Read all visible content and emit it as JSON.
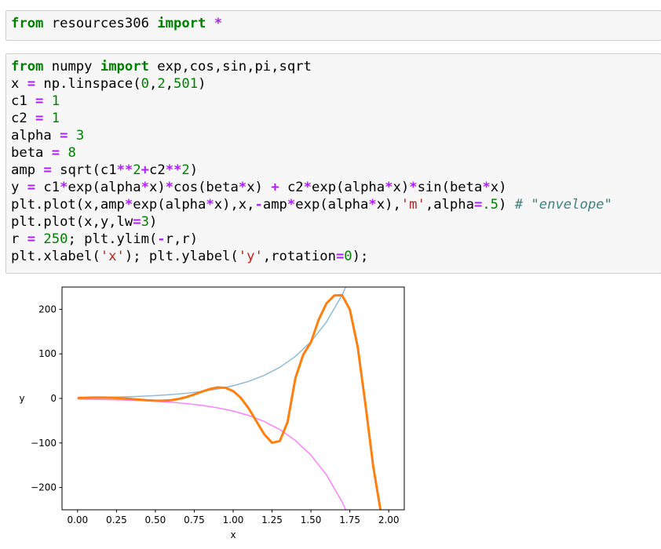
{
  "cells": [
    {
      "lines": [
        [
          {
            "t": "kw",
            "v": "from"
          },
          {
            "t": "plain",
            "v": " resources306 "
          },
          {
            "t": "kw",
            "v": "import"
          },
          {
            "t": "plain",
            "v": " "
          },
          {
            "t": "op",
            "v": "*"
          }
        ]
      ]
    },
    {
      "lines": [
        [
          {
            "t": "kw",
            "v": "from"
          },
          {
            "t": "plain",
            "v": " numpy "
          },
          {
            "t": "kw",
            "v": "import"
          },
          {
            "t": "plain",
            "v": " exp,cos,sin,pi,sqrt"
          }
        ],
        [
          {
            "t": "plain",
            "v": "x "
          },
          {
            "t": "op",
            "v": "="
          },
          {
            "t": "plain",
            "v": " np.linspace("
          },
          {
            "t": "num",
            "v": "0"
          },
          {
            "t": "plain",
            "v": ","
          },
          {
            "t": "num",
            "v": "2"
          },
          {
            "t": "plain",
            "v": ","
          },
          {
            "t": "num",
            "v": "501"
          },
          {
            "t": "plain",
            "v": ")"
          }
        ],
        [
          {
            "t": "plain",
            "v": "c1 "
          },
          {
            "t": "op",
            "v": "="
          },
          {
            "t": "plain",
            "v": " "
          },
          {
            "t": "num",
            "v": "1"
          }
        ],
        [
          {
            "t": "plain",
            "v": "c2 "
          },
          {
            "t": "op",
            "v": "="
          },
          {
            "t": "plain",
            "v": " "
          },
          {
            "t": "num",
            "v": "1"
          }
        ],
        [
          {
            "t": "plain",
            "v": "alpha "
          },
          {
            "t": "op",
            "v": "="
          },
          {
            "t": "plain",
            "v": " "
          },
          {
            "t": "num",
            "v": "3"
          }
        ],
        [
          {
            "t": "plain",
            "v": "beta "
          },
          {
            "t": "op",
            "v": "="
          },
          {
            "t": "plain",
            "v": " "
          },
          {
            "t": "num",
            "v": "8"
          }
        ],
        [
          {
            "t": "plain",
            "v": "amp "
          },
          {
            "t": "op",
            "v": "="
          },
          {
            "t": "plain",
            "v": " sqrt(c1"
          },
          {
            "t": "op",
            "v": "**"
          },
          {
            "t": "num",
            "v": "2"
          },
          {
            "t": "op",
            "v": "+"
          },
          {
            "t": "plain",
            "v": "c2"
          },
          {
            "t": "op",
            "v": "**"
          },
          {
            "t": "num",
            "v": "2"
          },
          {
            "t": "plain",
            "v": ")"
          }
        ],
        [
          {
            "t": "plain",
            "v": "y "
          },
          {
            "t": "op",
            "v": "="
          },
          {
            "t": "plain",
            "v": " c1"
          },
          {
            "t": "op",
            "v": "*"
          },
          {
            "t": "plain",
            "v": "exp(alpha"
          },
          {
            "t": "op",
            "v": "*"
          },
          {
            "t": "plain",
            "v": "x)"
          },
          {
            "t": "op",
            "v": "*"
          },
          {
            "t": "plain",
            "v": "cos(beta"
          },
          {
            "t": "op",
            "v": "*"
          },
          {
            "t": "plain",
            "v": "x) "
          },
          {
            "t": "op",
            "v": "+"
          },
          {
            "t": "plain",
            "v": " c2"
          },
          {
            "t": "op",
            "v": "*"
          },
          {
            "t": "plain",
            "v": "exp(alpha"
          },
          {
            "t": "op",
            "v": "*"
          },
          {
            "t": "plain",
            "v": "x)"
          },
          {
            "t": "op",
            "v": "*"
          },
          {
            "t": "plain",
            "v": "sin(beta"
          },
          {
            "t": "op",
            "v": "*"
          },
          {
            "t": "plain",
            "v": "x)"
          }
        ],
        [
          {
            "t": "plain",
            "v": "plt.plot(x,amp"
          },
          {
            "t": "op",
            "v": "*"
          },
          {
            "t": "plain",
            "v": "exp(alpha"
          },
          {
            "t": "op",
            "v": "*"
          },
          {
            "t": "plain",
            "v": "x),x,"
          },
          {
            "t": "op",
            "v": "-"
          },
          {
            "t": "plain",
            "v": "amp"
          },
          {
            "t": "op",
            "v": "*"
          },
          {
            "t": "plain",
            "v": "exp(alpha"
          },
          {
            "t": "op",
            "v": "*"
          },
          {
            "t": "plain",
            "v": "x),"
          },
          {
            "t": "str",
            "v": "'m'"
          },
          {
            "t": "plain",
            "v": ",alpha"
          },
          {
            "t": "op",
            "v": "="
          },
          {
            "t": "num",
            "v": ".5"
          },
          {
            "t": "plain",
            "v": ") "
          },
          {
            "t": "cmt",
            "v": "# \"envelope\""
          }
        ],
        [
          {
            "t": "plain",
            "v": "plt.plot(x,y,lw"
          },
          {
            "t": "op",
            "v": "="
          },
          {
            "t": "num",
            "v": "3"
          },
          {
            "t": "plain",
            "v": ")"
          }
        ],
        [
          {
            "t": "plain",
            "v": "r "
          },
          {
            "t": "op",
            "v": "="
          },
          {
            "t": "plain",
            "v": " "
          },
          {
            "t": "num",
            "v": "250"
          },
          {
            "t": "plain",
            "v": "; plt.ylim("
          },
          {
            "t": "op",
            "v": "-"
          },
          {
            "t": "plain",
            "v": "r,r)"
          }
        ],
        [
          {
            "t": "plain",
            "v": "plt.xlabel("
          },
          {
            "t": "str",
            "v": "'x'"
          },
          {
            "t": "plain",
            "v": "); plt.ylabel("
          },
          {
            "t": "str",
            "v": "'y'"
          },
          {
            "t": "plain",
            "v": ",rotation"
          },
          {
            "t": "op",
            "v": "="
          },
          {
            "t": "num",
            "v": "0"
          },
          {
            "t": "plain",
            "v": ");"
          }
        ]
      ]
    }
  ],
  "chart_data": {
    "type": "line",
    "xlabel": "x",
    "ylabel": "y",
    "xlim": [
      -0.1,
      2.1
    ],
    "ylim": [
      -250,
      250
    ],
    "x_ticks": [
      0.0,
      0.25,
      0.5,
      0.75,
      1.0,
      1.25,
      1.5,
      1.75,
      2.0
    ],
    "x_tick_labels": [
      "0.00",
      "0.25",
      "0.50",
      "0.75",
      "1.00",
      "1.25",
      "1.50",
      "1.75",
      "2.00"
    ],
    "y_ticks": [
      200,
      100,
      0,
      -100,
      -200
    ],
    "y_tick_labels": [
      "200",
      "100",
      "0",
      "−100",
      "−200"
    ],
    "grid": false,
    "series": [
      {
        "color": "#1f77b4",
        "opacity": 0.5,
        "line_width": 1.5,
        "x": [
          0.0,
          0.1,
          0.2,
          0.3,
          0.4,
          0.5,
          0.6,
          0.7,
          0.8,
          0.9,
          1.0,
          1.1,
          1.2,
          1.3,
          1.4,
          1.5,
          1.6,
          1.7,
          1.73,
          1.76
        ],
        "values": [
          1.41,
          1.91,
          2.58,
          3.48,
          4.7,
          6.34,
          8.56,
          11.55,
          15.59,
          21.04,
          28.4,
          38.34,
          51.76,
          69.86,
          94.3,
          127.29,
          171.82,
          231.93,
          254.9,
          279.4
        ]
      },
      {
        "color": "#ff00ff",
        "opacity": 0.5,
        "line_width": 1.5,
        "x": [
          0.0,
          0.1,
          0.2,
          0.3,
          0.4,
          0.5,
          0.6,
          0.7,
          0.8,
          0.9,
          1.0,
          1.1,
          1.2,
          1.3,
          1.4,
          1.5,
          1.6,
          1.7,
          1.73,
          1.76
        ],
        "values": [
          -1.41,
          -1.91,
          -2.58,
          -3.48,
          -4.7,
          -6.34,
          -8.56,
          -11.55,
          -15.59,
          -21.04,
          -28.4,
          -38.34,
          -51.76,
          -69.86,
          -94.3,
          -127.29,
          -171.82,
          -231.93,
          -254.9,
          -279.4
        ]
      },
      {
        "color": "#ff7f0e",
        "opacity": 1,
        "line_width": 3,
        "x": [
          0.0,
          0.05,
          0.1,
          0.15,
          0.2,
          0.25,
          0.3,
          0.35,
          0.4,
          0.45,
          0.5,
          0.55,
          0.6,
          0.65,
          0.7,
          0.75,
          0.8,
          0.85,
          0.9,
          0.95,
          1.0,
          1.05,
          1.1,
          1.15,
          1.2,
          1.25,
          1.3,
          1.35,
          1.4,
          1.45,
          1.5,
          1.55,
          1.6,
          1.65,
          1.7,
          1.75,
          1.8,
          1.85,
          1.9,
          1.95
        ],
        "values": [
          1.0,
          1.54,
          1.91,
          2.01,
          1.77,
          1.12,
          0.07,
          -1.31,
          -2.82,
          -4.19,
          -5.08,
          -5.11,
          -3.92,
          -1.2,
          3.14,
          8.85,
          15.27,
          21.14,
          24.71,
          23.87,
          16.5,
          1.0,
          -22.56,
          -51.67,
          -80.56,
          -99.57,
          -95.57,
          -52.73,
          45.63,
          97.85,
          126.07,
          176.95,
          213.47,
          231.06,
          231.73,
          199.55,
          116.47,
          -12.31,
          -151.58,
          -257.0
        ]
      }
    ]
  }
}
